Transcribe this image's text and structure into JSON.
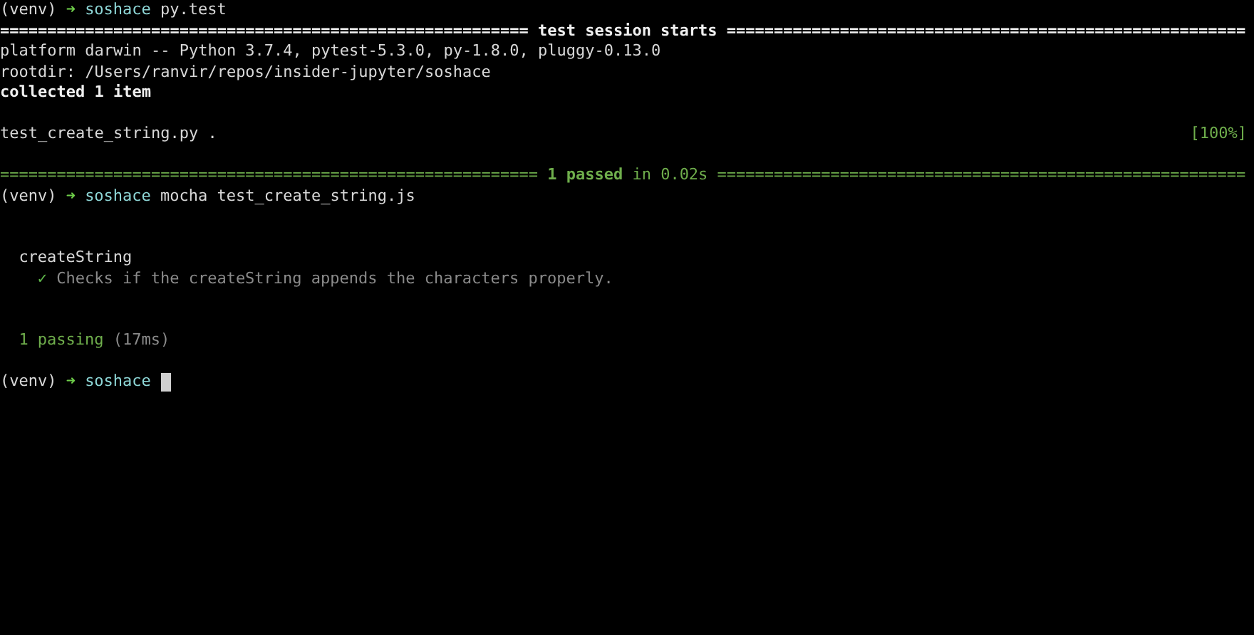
{
  "terminal": {
    "lines": [
      {
        "kind": "prompt",
        "venv": "(venv)",
        "arrow": "➜",
        "dir": "soshace",
        "command": "py.test",
        "cursor": false
      },
      {
        "kind": "rule",
        "fill_left": "========================================================",
        "label": "test session starts",
        "fill_right": "======================================================="
      },
      {
        "kind": "text",
        "text": "platform darwin -- Python 3.7.4, pytest-5.3.0, py-1.8.0, pluggy-0.13.0",
        "bold": false
      },
      {
        "kind": "text",
        "text": "rootdir: /Users/ranvir/repos/insider-jupyter/soshace",
        "bold": false
      },
      {
        "kind": "text",
        "text": "collected 1 item",
        "bold": true
      },
      {
        "kind": "blank"
      },
      {
        "kind": "progress",
        "text": "test_create_string.py .",
        "percent": "[100%]"
      },
      {
        "kind": "blank"
      },
      {
        "kind": "result_rule",
        "fill_left": "=========================================================",
        "label": "**1 passed** in 0.02s",
        "fill_right": "========================================================"
      },
      {
        "kind": "prompt",
        "venv": "(venv)",
        "arrow": "➜",
        "dir": "soshace",
        "command": "mocha test_create_string.js",
        "cursor": false
      },
      {
        "kind": "blank"
      },
      {
        "kind": "blank"
      },
      {
        "kind": "suite",
        "title": "createString",
        "children": [
          {
            "mark": "✓",
            "text": "Checks if the createString appends the characters properly."
          }
        ]
      },
      {
        "kind": "blank"
      },
      {
        "kind": "blank"
      },
      {
        "kind": "summary",
        "count": "1 passing",
        "time": "(17ms)"
      },
      {
        "kind": "blank"
      },
      {
        "kind": "prompt",
        "venv": "(venv)",
        "arrow": "➜",
        "dir": "soshace",
        "cursor": true
      }
    ]
  }
}
